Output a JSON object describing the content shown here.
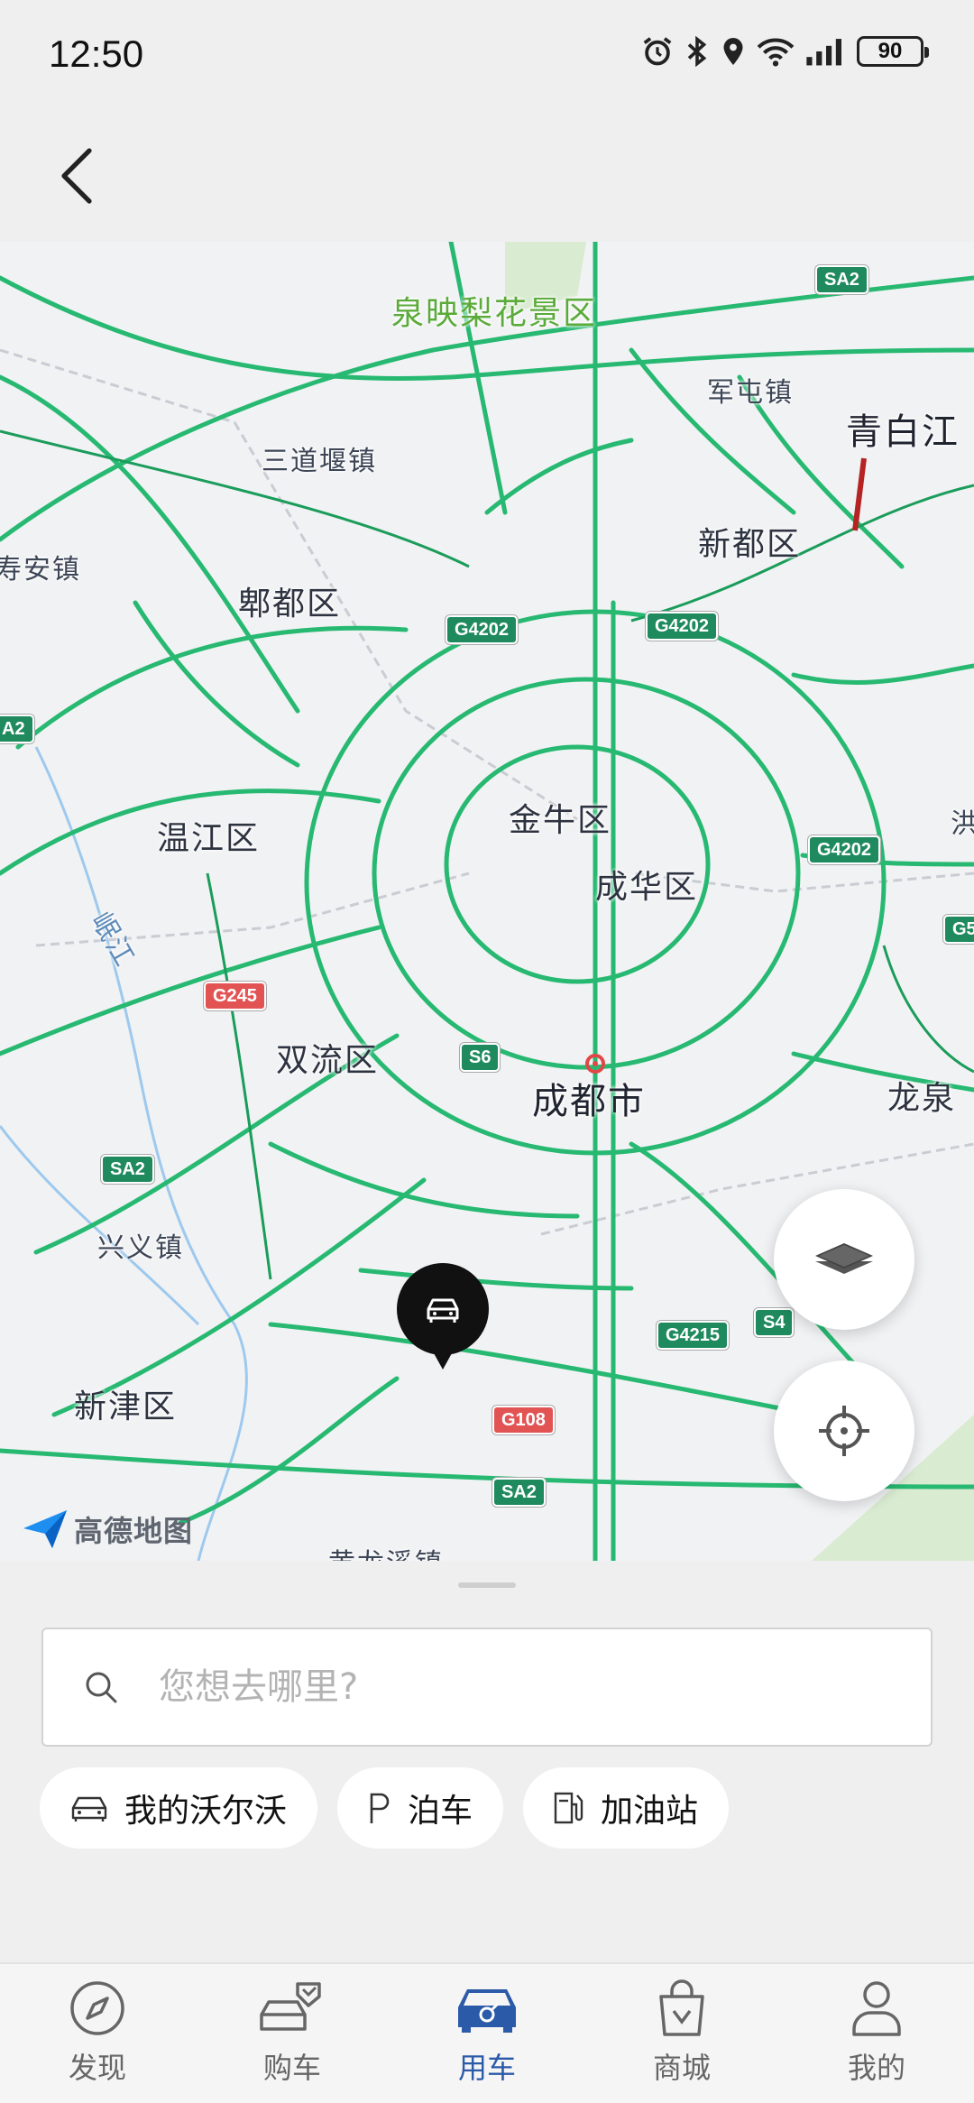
{
  "status_bar": {
    "time": "12:50",
    "battery": "90"
  },
  "map": {
    "labels": {
      "quanying": "泉映梨花景区",
      "juntun": "军屯镇",
      "qingbaijiang": "青白江",
      "sandaoyan": "三道堰镇",
      "xindu": "新都区",
      "shouan": "寿安镇",
      "pidu": "郫都区",
      "jinniu": "金牛区",
      "chenghua": "成华区",
      "wenjiang": "温江区",
      "minjiang": "岷江",
      "hong": "洪",
      "shuangliu": "双流区",
      "chengdu": "成都市",
      "longquan": "龙泉",
      "xingyi": "兴义镇",
      "xinjin": "新津区",
      "huanglongxi": "黄龙溪镇"
    },
    "shields": {
      "sa2_top": "SA2",
      "g4202_left": "G4202",
      "g4202_mid": "G4202",
      "sa2_left": "A2",
      "g4202_right": "G4202",
      "g5": "G5",
      "g245": "G245",
      "s6": "S6",
      "sa2_mid": "SA2",
      "g4215": "G4215",
      "s4": "S4",
      "g108": "G108",
      "sa2_bottom": "SA2"
    },
    "attribution": "高德地图"
  },
  "search": {
    "placeholder": "您想去哪里?"
  },
  "chips": [
    {
      "label": "我的沃尔沃",
      "icon": "car-icon"
    },
    {
      "label": "泊车",
      "icon": "parking-icon"
    },
    {
      "label": "加油站",
      "icon": "fuel-icon"
    }
  ],
  "tabs": [
    {
      "label": "发现",
      "icon": "compass-icon",
      "active": false
    },
    {
      "label": "购车",
      "icon": "car-tag-icon",
      "active": false
    },
    {
      "label": "用车",
      "icon": "car-front-icon",
      "active": true
    },
    {
      "label": "商城",
      "icon": "shopping-bag-icon",
      "active": false
    },
    {
      "label": "我的",
      "icon": "user-icon",
      "active": false
    }
  ],
  "colors": {
    "accent": "#2b5aa8",
    "road": "#2ec27e",
    "background": "#efefef"
  }
}
